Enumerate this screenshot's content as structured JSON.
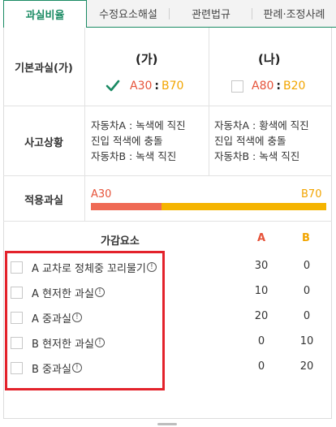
{
  "tabs": [
    {
      "label": "과실비율",
      "active": true
    },
    {
      "label": "수정요소해설",
      "active": false
    },
    {
      "label": "관련법규",
      "active": false
    },
    {
      "label": "판례·조정사례",
      "active": false
    }
  ],
  "basic": {
    "label": "기본과실(가)",
    "col_a": {
      "head": "(가)",
      "checked": true,
      "a": "A30",
      "sep": ":",
      "b": "B70"
    },
    "col_b": {
      "head": "(나)",
      "checked": false,
      "a": "A80",
      "sep": ":",
      "b": "B20"
    }
  },
  "situation": {
    "label": "사고상황",
    "col_a": [
      "자동차A : 녹색에 직진",
      "진입 적색에 충돌",
      "자동차B : 녹색 직진"
    ],
    "col_b": [
      "자동차A : 황색에 직진",
      "진입 적색에 충돌",
      "자동차B : 녹색 직진"
    ]
  },
  "applied": {
    "label": "적용과실",
    "a_label": "A30",
    "b_label": "B70",
    "a_value": 30,
    "b_value": 70
  },
  "factors": {
    "header": "가감요소",
    "col_a": "A",
    "col_b": "B",
    "items": [
      {
        "label": "A 교차로 정체중 꼬리물기",
        "a": "30",
        "b": "0"
      },
      {
        "label": "A 현저한 과실",
        "a": "10",
        "b": "0"
      },
      {
        "label": "A 중과실",
        "a": "20",
        "b": "0"
      },
      {
        "label": "B 현저한 과실",
        "a": "0",
        "b": "10"
      },
      {
        "label": "B 중과실",
        "a": "0",
        "b": "20"
      }
    ]
  },
  "colors": {
    "accent": "#1a8a63",
    "party_a": "#e6533a",
    "party_b": "#f2a500",
    "highlight": "#e3222b"
  }
}
